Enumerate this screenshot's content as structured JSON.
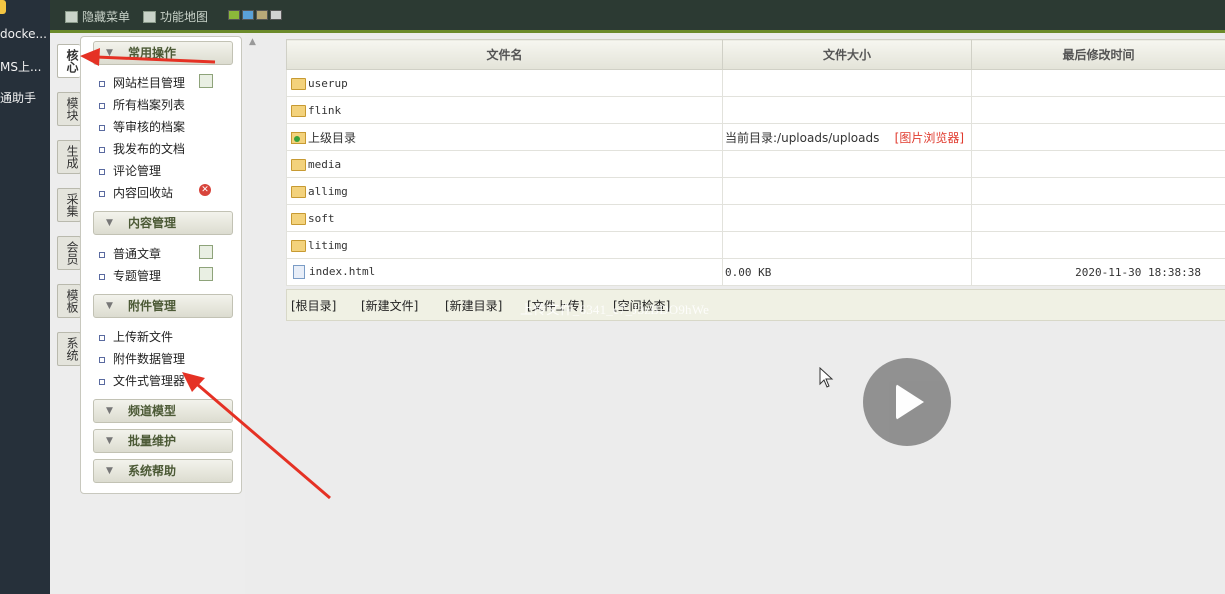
{
  "host_sidebar": {
    "items": [
      "docke...",
      "MS上...",
      "通助手"
    ]
  },
  "toolbar": {
    "hide_menu_label": "隐藏菜单",
    "site_map_label": "功能地图",
    "theme_colors": [
      "#8cb83a",
      "#5aa0d8",
      "#b8a878",
      "#d0d0d0"
    ]
  },
  "vertical_tabs": [
    {
      "label": "核心",
      "active": true
    },
    {
      "label": "模块",
      "active": false
    },
    {
      "label": "生成",
      "active": false
    },
    {
      "label": "采集",
      "active": false
    },
    {
      "label": "会员",
      "active": false
    },
    {
      "label": "模板",
      "active": false
    },
    {
      "label": "系统",
      "active": false
    }
  ],
  "sidebar": {
    "sections": [
      {
        "title": "常用操作",
        "items": [
          {
            "label": "网站栏目管理",
            "action": "add"
          },
          {
            "label": "所有档案列表"
          },
          {
            "label": "等审核的档案"
          },
          {
            "label": "我发布的文档"
          },
          {
            "label": "评论管理"
          },
          {
            "label": "内容回收站",
            "action": "delete"
          }
        ]
      },
      {
        "title": "内容管理",
        "items": [
          {
            "label": "普通文章",
            "action": "add"
          },
          {
            "label": "专题管理",
            "action": "add"
          }
        ]
      },
      {
        "title": "附件管理",
        "items": [
          {
            "label": "上传新文件"
          },
          {
            "label": "附件数据管理"
          },
          {
            "label": "文件式管理器"
          }
        ]
      },
      {
        "title": "频道模型",
        "items": []
      },
      {
        "title": "批量维护",
        "items": []
      },
      {
        "title": "系统帮助",
        "items": []
      }
    ]
  },
  "file_table": {
    "headers": [
      "文件名",
      "文件大小",
      "最后修改时间"
    ],
    "rows": [
      {
        "type": "folder",
        "name": "userup",
        "size": "",
        "mtime": ""
      },
      {
        "type": "folder",
        "name": "flink",
        "size": "",
        "mtime": ""
      },
      {
        "type": "parent",
        "name": "上级目录",
        "size": "当前目录:/uploads/uploads",
        "link": "[图片浏览器]",
        "mtime": ""
      },
      {
        "type": "folder",
        "name": "media",
        "size": "",
        "mtime": ""
      },
      {
        "type": "folder",
        "name": "allimg",
        "size": "",
        "mtime": ""
      },
      {
        "type": "folder",
        "name": "soft",
        "size": "",
        "mtime": ""
      },
      {
        "type": "folder",
        "name": "litimg",
        "size": "",
        "mtime": ""
      },
      {
        "type": "file",
        "name": "index.html",
        "size": "0.00 KB",
        "mtime": "2020-11-30 18:38:38"
      }
    ]
  },
  "bottom_bar": {
    "links": [
      "[根目录]",
      "[新建文件]",
      "[新建目录]",
      "[文件上传]",
      "[空间检查]"
    ],
    "overlay_text": "上传文件_6341_c7_J3zBDO9hWe"
  }
}
